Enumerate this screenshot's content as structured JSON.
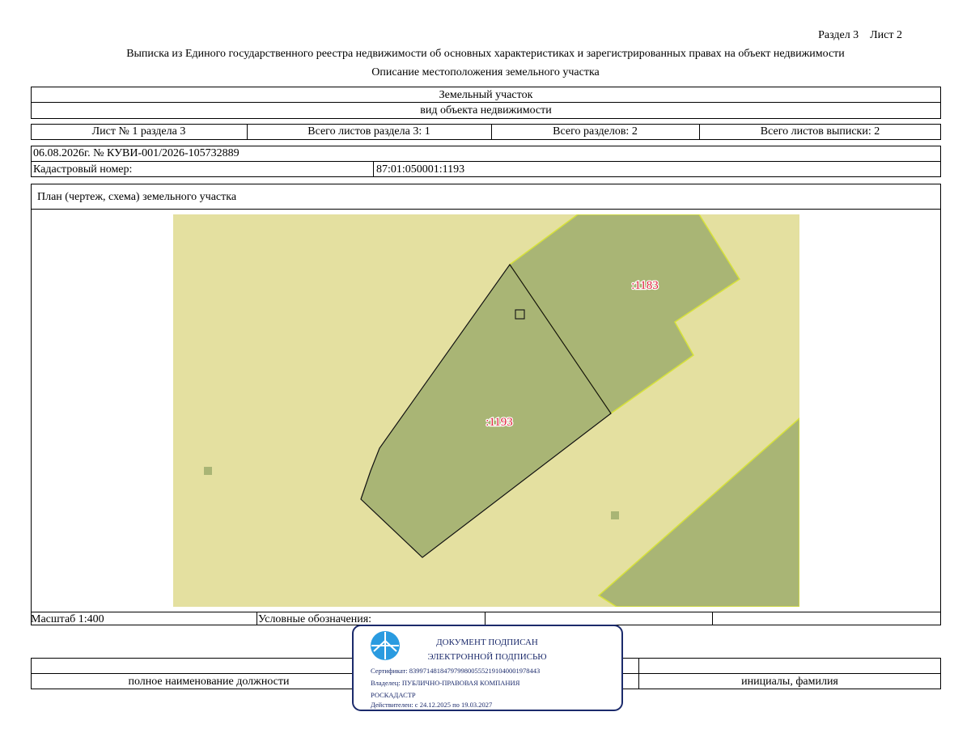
{
  "header": {
    "section_sheet": "Раздел 3    Лист 2",
    "title": "Выписка из Единого государственного реестра недвижимости об основных характеристиках и зарегистрированных правах на объект недвижимости",
    "subtitle": "Описание местоположения земельного участка"
  },
  "object": {
    "type": "Земельный участок",
    "type_caption": "вид объекта недвижимости"
  },
  "sheets": {
    "sheet_no": "Лист № 1 раздела 3",
    "total_section_sheets": "Всего листов раздела 3: 1",
    "total_sections": "Всего разделов: 2",
    "total_extract_sheets": "Всего листов выписки: 2"
  },
  "doc": {
    "date_number": "06.08.2026г. № КУВИ-001/2026-105732889",
    "cadastral_label": "Кадастровый номер:",
    "cadastral_value": "87:01:050001:1193"
  },
  "plan": {
    "title": "План (чертеж, схема) земельного участка",
    "parcel_main_label": ":1193",
    "parcel_neighbor_label": ":1183",
    "scale": "Масштаб 1:400",
    "legend_label": "Условные обозначения:"
  },
  "signature": {
    "position_caption": "полное наименование должности",
    "name_caption": "инициалы, фамилия"
  },
  "stamp": {
    "line1": "ДОКУМЕНТ ПОДПИСАН",
    "line2": "ЭЛЕКТРОННОЙ ПОДПИСЬЮ",
    "certificate": "Сертификат: 8399714818479799800555219104000197844З",
    "owner": "Владелец: ПУБЛИЧНО-ПРАВОВАЯ КОМПАНИЯ",
    "owner2": "РОСКАДАСТР",
    "valid": "Действителен: с 24.12.2025 по 19.03.2027"
  },
  "colors": {
    "background_land": "#e4e0a0",
    "parcel_fill": "#a9b575",
    "parcel_edge": "#d7e23a",
    "label_red": "#e0203a",
    "stamp_blue": "#1b2a6b"
  }
}
